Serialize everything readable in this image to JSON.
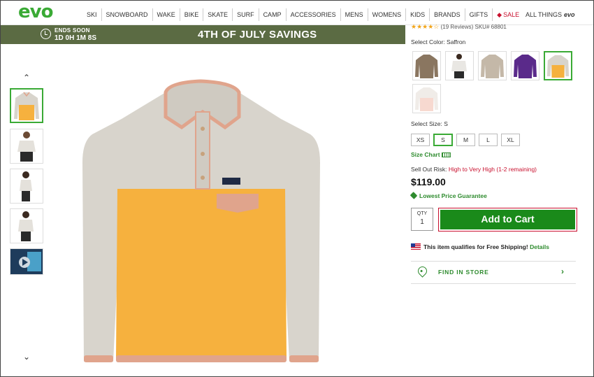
{
  "header": {
    "logo": "evo",
    "nav": [
      "SKI",
      "SNOWBOARD",
      "WAKE",
      "BIKE",
      "SKATE",
      "SURF",
      "CAMP",
      "ACCESSORIES",
      "MENS",
      "WOMENS",
      "KIDS",
      "BRANDS",
      "GIFTS"
    ],
    "sale": "SALE",
    "all_things": "ALL THINGS",
    "all_things_logo": "evo"
  },
  "promo": {
    "ends_soon": "ENDS SOON",
    "countdown": "1D 0H 1M 8S",
    "title": "4TH OF JULY SAVINGS"
  },
  "product": {
    "stars": "★★★★☆",
    "reviews": "(19 Reviews)",
    "sku": "SKU# 68801",
    "color_label": "Select Color: Saffron",
    "size_label": "Select Size: S",
    "sizes": [
      "XS",
      "S",
      "M",
      "L",
      "XL"
    ],
    "selected_size": "S",
    "size_chart": "Size Chart",
    "sellout_label": "Sell Out Risk:",
    "sellout_risk": "High to Very High (1-2 remaining)",
    "price": "$119.00",
    "lowest_price": "Lowest Price Guarantee",
    "qty_label": "QTY",
    "qty_value": "1",
    "add_to_cart": "Add to Cart",
    "shipping_text": "This item qualifies for Free Shipping!",
    "shipping_details": "Details",
    "find_store": "FIND IN STORE"
  },
  "colors": {
    "accent": "#3aaa35",
    "banner": "#5b6b43",
    "cart_button": "#1a8a1a",
    "saffron": "#f6b13e",
    "fleece": "#d8d4cc",
    "trim": "#e0a48c"
  }
}
